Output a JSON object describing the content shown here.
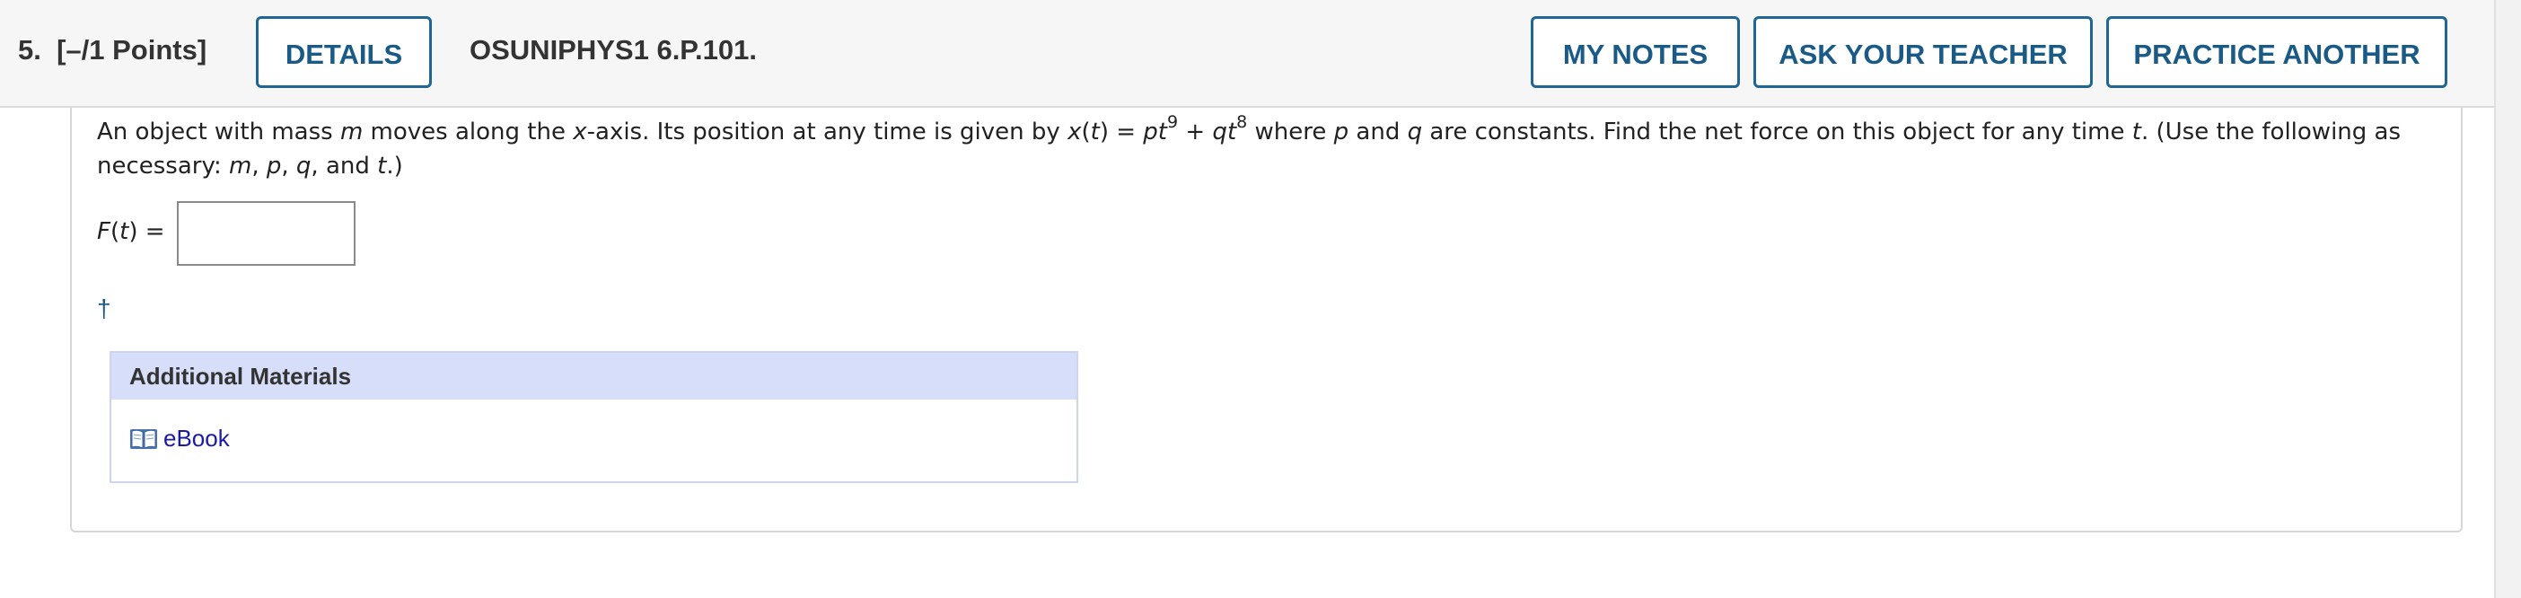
{
  "header": {
    "question_number": "5.",
    "points": "[–/1 Points]",
    "details_label": "DETAILS",
    "problem_code": "OSUNIPHYS1 6.P.101.",
    "my_notes_label": "MY NOTES",
    "ask_teacher_label": "ASK YOUR TEACHER",
    "practice_label": "PRACTICE ANOTHER"
  },
  "question": {
    "t1": "An object with mass ",
    "v_m": "m",
    "t2": " moves along the ",
    "v_x": "x",
    "t3": "-axis. Its position at any time is given by ",
    "v_xt": "x",
    "t4": "(",
    "v_t1": "t",
    "t5": ") = ",
    "v_p": "p",
    "v_t2": "t",
    "exp1": "9",
    "t6": " + ",
    "v_q": "q",
    "v_t3": "t",
    "exp2": "8",
    "t7": " where ",
    "v_p2": "p",
    "t8": " and ",
    "v_q2": "q",
    "t9": " are constants. Find the net force on this object for any time ",
    "v_t4": "t",
    "t10": ". (Use the following as necessary: ",
    "v_m2": "m",
    "t11": ", ",
    "v_p3": "p",
    "t12": ", ",
    "v_q3": "q",
    "t13": ", and ",
    "v_t5": "t",
    "t14": ".)"
  },
  "answer": {
    "label_f": "F",
    "label_paren_open": "(",
    "label_t": "t",
    "label_rest": ") =",
    "value": ""
  },
  "dagger": "†",
  "materials": {
    "heading": "Additional Materials",
    "ebook_label": "eBook",
    "ebook_icon": "book-icon"
  },
  "colors": {
    "accent": "#1f6596",
    "materials_header": "#d7defa",
    "link": "#1a1aaa"
  }
}
